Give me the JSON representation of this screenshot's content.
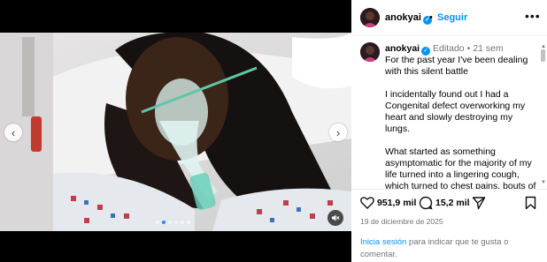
{
  "post": {
    "username": "anokyai",
    "verified_icon": "verified-badge-icon",
    "follow_label": "Seguir",
    "separator": "•",
    "edited_label": "Editado",
    "age": "21 sem",
    "caption_paragraphs": [
      "For the past year I've been dealing with this silent battle",
      "I incidentally found out I had a Congenital defect overworking my heart and slowly destroying my lungs.",
      "What started as something asymptomatic for the majority of my life turned into a lingering cough, which turned to chest pains, bouts of coughing up blood, then at times struggling to breathe."
    ],
    "likes": "951,9 mil",
    "comments": "15,2 mil",
    "date": "19 de diciembre de 2025",
    "login_link": "Inicia sesión",
    "login_rest": " para indicar que te gusta o comentar."
  },
  "carousel": {
    "slide_count": 6,
    "active_slide": 1
  },
  "colors": {
    "accent": "#0095f6",
    "muted": "#737373",
    "active_dot": "#2b8cf2"
  }
}
